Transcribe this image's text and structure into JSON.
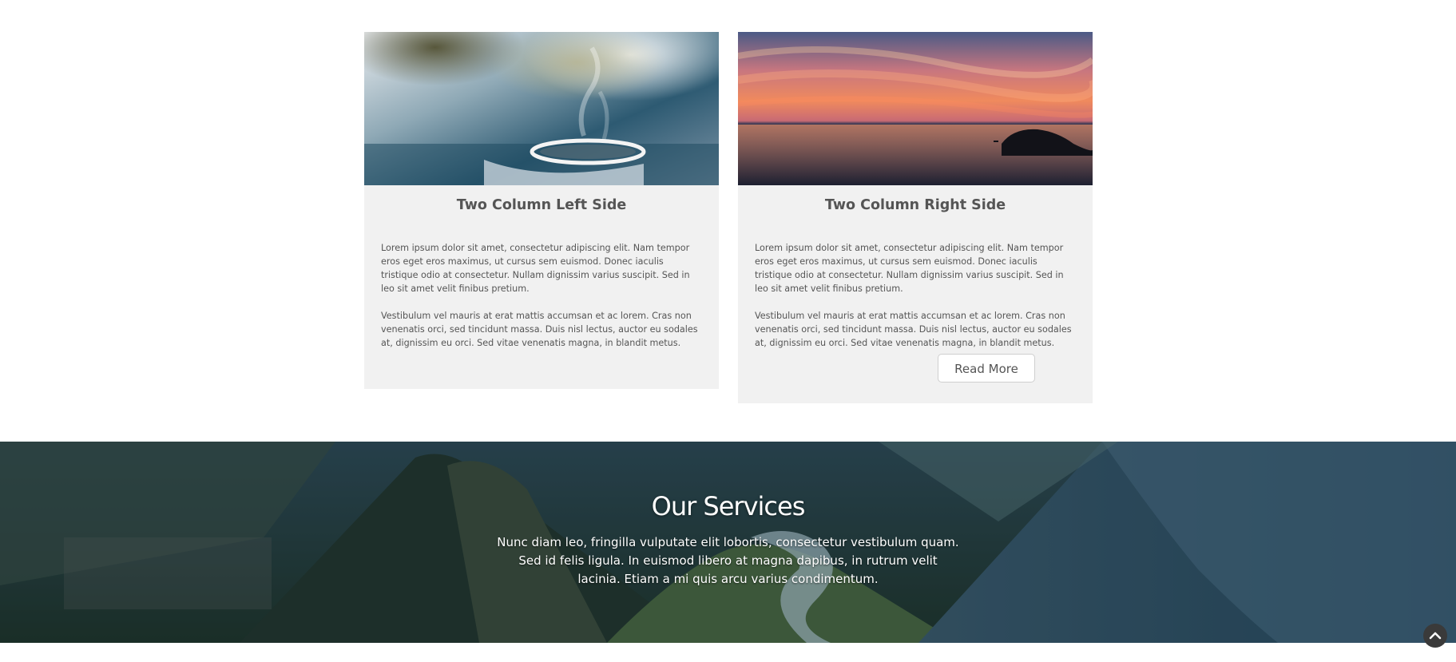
{
  "columns": {
    "left": {
      "image_icon": "steaming-cup-image",
      "title": "Two Column Left Side",
      "paragraph1": "Lorem ipsum dolor sit amet, consectetur adipiscing elit. Nam tempor eros eget eros maximus, ut cursus sem euismod. Donec iaculis tristique odio at consectetur. Nullam dignissim varius suscipit. Sed in leo sit amet velit finibus pretium.",
      "paragraph2": "Vestibulum vel mauris at erat mattis accumsan et ac lorem. Cras non venenatis orci, sed tincidunt massa. Duis nisl lectus, auctor eu sodales at, dignissim eu orci. Sed vitae venenatis magna, in blandit metus."
    },
    "right": {
      "image_icon": "sunset-sea-image",
      "title": "Two Column Right Side",
      "paragraph1": "Lorem ipsum dolor sit amet, consectetur adipiscing elit. Nam tempor eros eget eros maximus, ut cursus sem euismod. Donec iaculis tristique odio at consectetur. Nullam dignissim varius suscipit. Sed in leo sit amet velit finibus pretium.",
      "paragraph2": "Vestibulum vel mauris at erat mattis accumsan et ac lorem. Cras non venenatis orci, sed tincidunt massa. Duis nisl lectus, auctor eu sodales at, dignissim eu orci. Sed vitae venenatis magna, in blandit metus.",
      "button_label": "Read More"
    }
  },
  "services": {
    "background_icon": "mountain-valley-image",
    "title": "Our Services",
    "text": "Nunc diam leo, fringilla vulputate elit lobortis, consectetur vestibulum quam. Sed id felis ligula. In euismod libero at magna dapibus, in rutrum velit lacinia. Etiam a mi quis arcu varius condimentum."
  },
  "back_to_top": {
    "icon": "chevron-up-icon"
  },
  "colors": {
    "card_background": "#f1f1f1",
    "text": "#555555",
    "button_border": "#cfcfcf",
    "back_to_top": "#3a3a3a"
  }
}
